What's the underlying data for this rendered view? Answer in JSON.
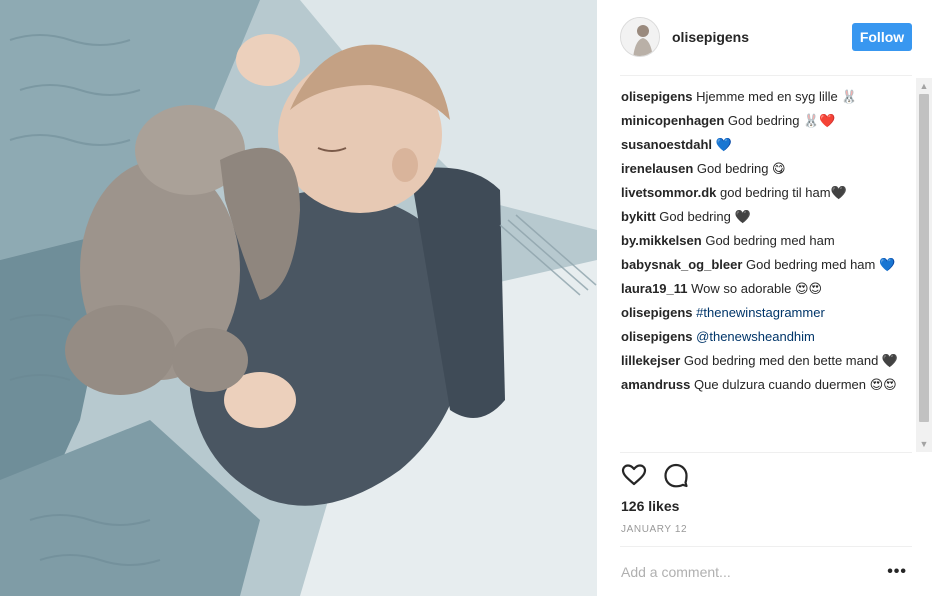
{
  "post": {
    "username": "olisepigens",
    "follow_label": "Follow",
    "likes": "126 likes",
    "date": "JANUARY 12",
    "comment_placeholder": "Add a comment...",
    "more_label": "•••"
  },
  "comments": [
    {
      "author": "olisepigens",
      "text": "Hjemme med en syg lille 🐰"
    },
    {
      "author": "minicopenhagen",
      "text": "God bedring 🐰❤️"
    },
    {
      "author": "susanoestdahl",
      "text": "💙"
    },
    {
      "author": "irenelausen",
      "text": "God bedring 😋"
    },
    {
      "author": "livetsommor.dk",
      "text": "god bedring til ham🖤"
    },
    {
      "author": "bykitt",
      "text": "God bedring 🖤"
    },
    {
      "author": "by.mikkelsen",
      "text": "God bedring med ham"
    },
    {
      "author": "babysnak_og_bleer",
      "text": "God bedring med ham 💙"
    },
    {
      "author": "laura19_11",
      "text": "Wow so adorable 😍😍"
    },
    {
      "author": "olisepigens",
      "text": "#thenewinstagrammer"
    },
    {
      "author": "olisepigens",
      "text": "@thenewsheandhim"
    },
    {
      "author": "lillekejser",
      "text": "God bedring med den bette mand 🖤"
    },
    {
      "author": "amandruss",
      "text": "Que dulzura cuando duermen 😍😍"
    }
  ],
  "icons": {
    "like": "heart-icon",
    "comment": "comment-bubble-icon",
    "scroll_up": "▲",
    "scroll_down": "▼"
  },
  "colors": {
    "follow_button": "#3897f0",
    "hashtag": "#003569",
    "date": "#999999"
  }
}
